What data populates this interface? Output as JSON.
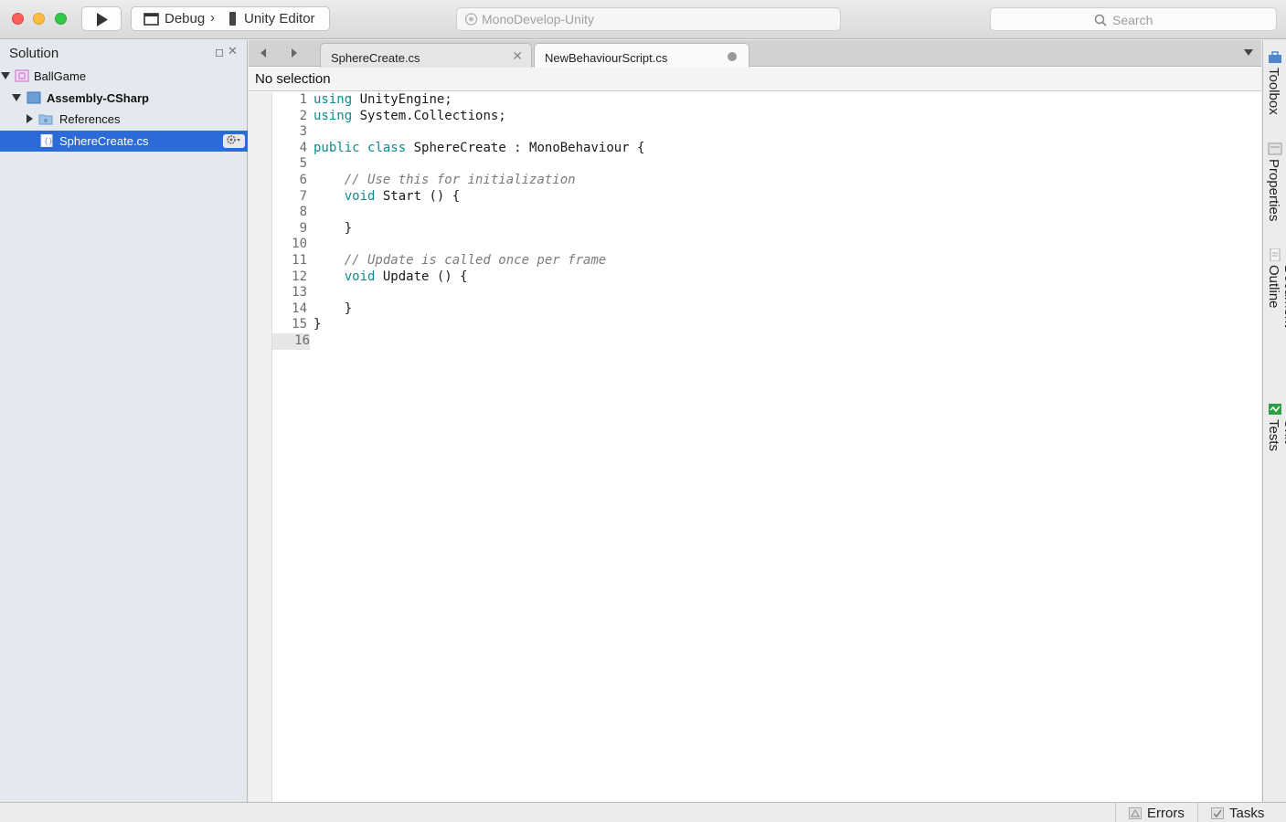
{
  "toolbar": {
    "configuration": "Debug",
    "separator": "›",
    "target": "Unity Editor",
    "status": "MonoDevelop-Unity",
    "search_placeholder": "Search"
  },
  "solution_pad": {
    "title": "Solution",
    "close_glyph": "✕",
    "items": [
      {
        "label": "BallGame"
      },
      {
        "label": "Assembly-CSharp"
      },
      {
        "label": "References"
      },
      {
        "label": "SphereCreate.cs"
      }
    ]
  },
  "tabs": [
    {
      "label": "SphereCreate.cs",
      "close_glyph": "✕"
    },
    {
      "label": "NewBehaviourScript.cs"
    }
  ],
  "pathbar": {
    "label": "No selection"
  },
  "code_lines": [
    {
      "n": "1",
      "segments": [
        {
          "t": "using",
          "k": "kw"
        },
        {
          "t": " UnityEngine;"
        }
      ]
    },
    {
      "n": "2",
      "segments": [
        {
          "t": "using",
          "k": "kw"
        },
        {
          "t": " System.Collections;"
        }
      ]
    },
    {
      "n": "3",
      "segments": []
    },
    {
      "n": "4",
      "segments": [
        {
          "t": "public",
          "k": "kw"
        },
        {
          "t": " "
        },
        {
          "t": "class",
          "k": "kw"
        },
        {
          "t": " SphereCreate : MonoBehaviour {"
        }
      ]
    },
    {
      "n": "5",
      "segments": []
    },
    {
      "n": "6",
      "segments": [
        {
          "t": "    "
        },
        {
          "t": "// Use this for initialization",
          "k": "cm"
        }
      ]
    },
    {
      "n": "7",
      "segments": [
        {
          "t": "    "
        },
        {
          "t": "void",
          "k": "kw"
        },
        {
          "t": " Start () {"
        }
      ]
    },
    {
      "n": "8",
      "segments": []
    },
    {
      "n": "9",
      "segments": [
        {
          "t": "    }"
        }
      ]
    },
    {
      "n": "10",
      "segments": []
    },
    {
      "n": "11",
      "segments": [
        {
          "t": "    "
        },
        {
          "t": "// Update is called once per frame",
          "k": "cm"
        }
      ]
    },
    {
      "n": "12",
      "segments": [
        {
          "t": "    "
        },
        {
          "t": "void",
          "k": "kw"
        },
        {
          "t": " Update () {"
        }
      ]
    },
    {
      "n": "13",
      "segments": []
    },
    {
      "n": "14",
      "segments": [
        {
          "t": "    }"
        }
      ]
    },
    {
      "n": "15",
      "segments": [
        {
          "t": "}"
        }
      ]
    },
    {
      "n": "16",
      "segments": [],
      "current": true
    }
  ],
  "right_dock": {
    "toolbox": "Toolbox",
    "properties": "Properties",
    "document_outline": "Document Outline",
    "unit_tests": "Unit Tests"
  },
  "bottom_pads": {
    "errors": "Errors",
    "tasks": "Tasks"
  },
  "colors": {
    "selection": "#2a6bd8",
    "keyword": "#0e8a8e",
    "comment": "#7b7b7b"
  }
}
